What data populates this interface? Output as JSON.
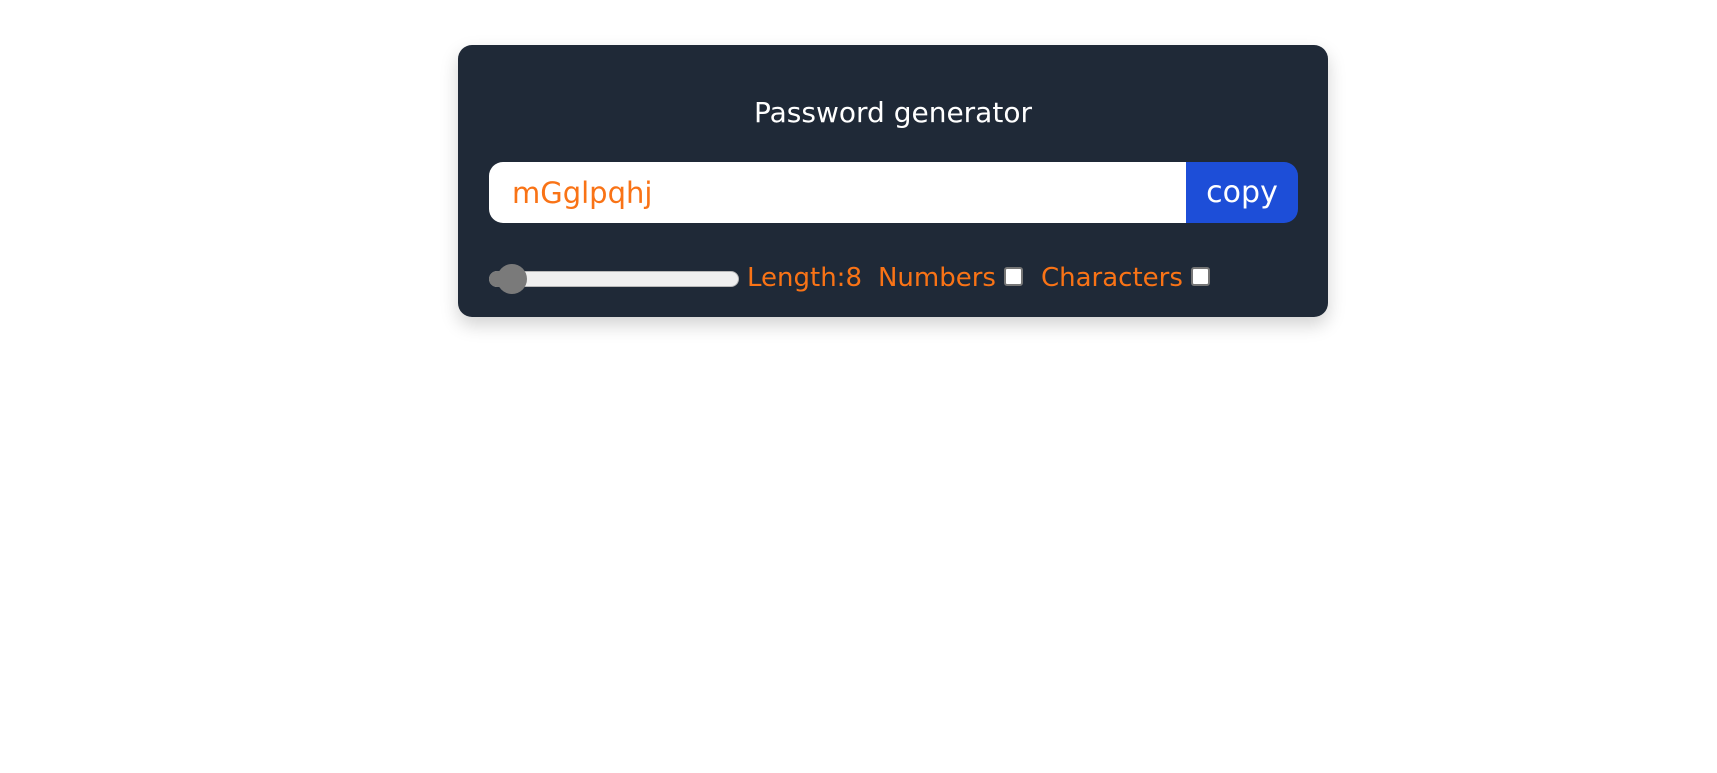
{
  "card": {
    "title": "Password generator"
  },
  "password": {
    "value": "mGglpqhj"
  },
  "copy_button": {
    "label": "copy"
  },
  "options": {
    "length_label": "Length:8",
    "length_slider": {
      "value": 8,
      "min": 6,
      "max": 100
    },
    "numbers_label": "Numbers",
    "numbers_checked": false,
    "characters_label": "Characters",
    "characters_checked": false
  },
  "colors": {
    "card_background": "#1f2937",
    "accent_orange": "#f97316",
    "button_blue": "#1d4ed8",
    "title_text": "#ffffff"
  }
}
